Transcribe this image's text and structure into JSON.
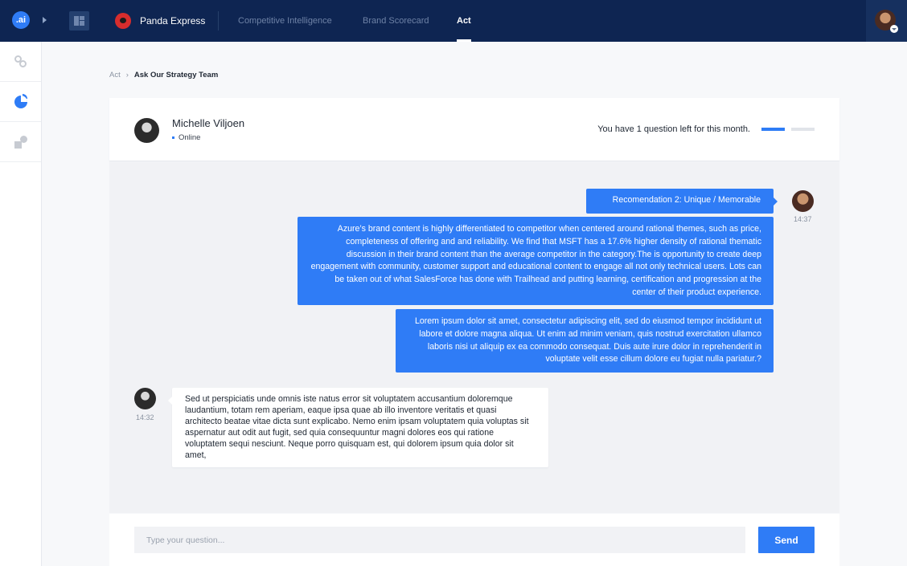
{
  "app": {
    "logo_text": ".ai"
  },
  "header": {
    "brand_name": "Panda Express",
    "tabs": [
      {
        "label": "Competitive Intelligence",
        "active": false
      },
      {
        "label": "Brand Scorecard",
        "active": false
      },
      {
        "label": "Act",
        "active": true
      }
    ]
  },
  "sidebar": {
    "items": [
      {
        "icon": "rings-icon",
        "active": false
      },
      {
        "icon": "pie-chart-icon",
        "active": true
      },
      {
        "icon": "shapes-icon",
        "active": false
      }
    ]
  },
  "breadcrumb": {
    "items": [
      "Act",
      "Ask Our Strategy Team"
    ]
  },
  "chat": {
    "agent": {
      "name": "Michelle Viljoen",
      "status": "Online"
    },
    "quota": {
      "text": "You have 1 question left for this month.",
      "used": 1,
      "total": 2
    },
    "messages": [
      {
        "from": "user",
        "text": "Recomendation 2: Unique / Memorable",
        "time": "14:37"
      },
      {
        "from": "user",
        "text": "Azure’s brand content is highly differentiated to competitor  when centered around rational themes,  such as price, completeness of offering and and reliability. We find that MSFT has a 17.6% higher density of rational thematic discussion in their brand content than the average competitor in the category.The is opportunity to create deep engagement with community, customer support and educational content to engage all not only technical users. Lots can be taken out of what SalesForce has done with Trailhead and putting learning, certification and progression at the center of their product experience."
      },
      {
        "from": "user",
        "text": "Lorem ipsum dolor sit amet, consectetur adipiscing elit, sed do eiusmod tempor incididunt ut labore et dolore magna aliqua. Ut enim ad minim veniam, quis nostrud exercitation ullamco laboris nisi ut aliquip ex ea commodo consequat. Duis aute irure dolor in reprehenderit in voluptate velit esse cillum dolore eu fugiat nulla pariatur.?"
      },
      {
        "from": "agent",
        "text": "Sed ut perspiciatis unde omnis iste natus error sit voluptatem accusantium doloremque laudantium, totam rem aperiam, eaque ipsa quae ab illo inventore veritatis et quasi architecto beatae vitae dicta sunt explicabo. Nemo enim ipsam voluptatem quia voluptas sit aspernatur aut odit aut fugit, sed quia consequuntur magni dolores eos qui ratione voluptatem sequi nesciunt. Neque porro quisquam est, qui dolorem ipsum quia dolor sit amet,",
        "time": "14:32"
      }
    ],
    "input": {
      "placeholder": "Type your question...",
      "value": ""
    },
    "send_label": "Send"
  },
  "colors": {
    "nav_background": "#0e2552",
    "accent": "#2f7cf6",
    "chat_background": "#f1f2f5"
  }
}
